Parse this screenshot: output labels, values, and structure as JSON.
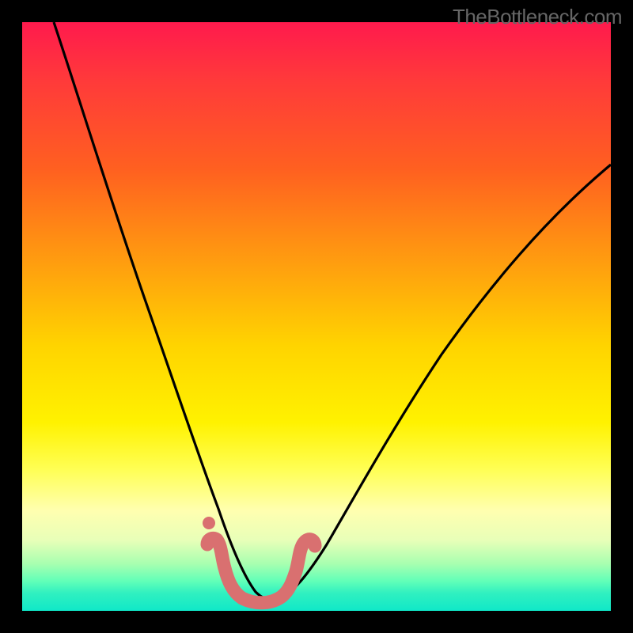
{
  "watermark": "TheBottleneck.com",
  "chart_data": {
    "type": "line",
    "title": "",
    "xlabel": "",
    "ylabel": "",
    "xlim": [
      0,
      100
    ],
    "ylim": [
      0,
      100
    ],
    "grid": false,
    "series": [
      {
        "name": "bottleneck-curve",
        "x": [
          5,
          8,
          12,
          16,
          20,
          24,
          27,
          30,
          32,
          34,
          36,
          38,
          40,
          42,
          44,
          48,
          52,
          56,
          60,
          66,
          72,
          78,
          85,
          92,
          100
        ],
        "y": [
          100,
          88,
          74,
          62,
          50,
          40,
          32,
          24,
          18,
          13,
          8,
          5,
          3,
          3,
          4,
          7,
          12,
          18,
          24,
          32,
          40,
          48,
          56,
          63,
          70
        ]
      }
    ],
    "annotations": [
      {
        "name": "ideal-zone-marker",
        "x_range": [
          30,
          45
        ],
        "y_level": 3
      }
    ],
    "gradient_bands": [
      {
        "color": "#ff1a4d",
        "stop": 0
      },
      {
        "color": "#ff9a10",
        "stop": 40
      },
      {
        "color": "#fff200",
        "stop": 68
      },
      {
        "color": "#30f0c0",
        "stop": 100
      }
    ]
  }
}
